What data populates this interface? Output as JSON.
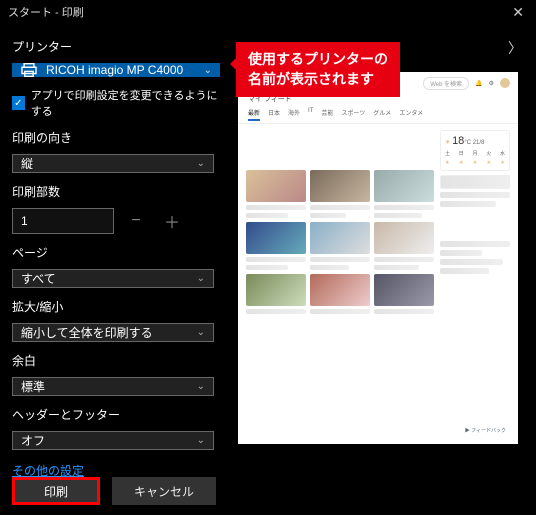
{
  "window": {
    "title": "スタート - 印刷"
  },
  "printer": {
    "section_label": "プリンター",
    "name": "RICOH imagio MP C4000",
    "app_override_label": "アプリで印刷設定を変更できるようにする"
  },
  "orientation": {
    "label": "印刷の向き",
    "value": "縦"
  },
  "copies": {
    "label": "印刷部数",
    "value": "1"
  },
  "pages": {
    "label": "ページ",
    "value": "すべて"
  },
  "scale": {
    "label": "拡大/縮小",
    "value": "縮小して全体を印刷する"
  },
  "margin": {
    "label": "余白",
    "value": "標準"
  },
  "header_footer": {
    "label": "ヘッダーとフッター",
    "value": "オフ"
  },
  "more_settings": "その他の設定",
  "buttons": {
    "print": "印刷",
    "cancel": "キャンセル"
  },
  "callout": {
    "line1": "使用するプリンターの",
    "line2": "名前が表示されます"
  },
  "preview": {
    "search_placeholder": "Web を検索",
    "feed_title": "マイ フィード",
    "tabs": [
      "最新",
      "日本",
      "海外",
      "IT",
      "芸能",
      "スポーツ",
      "グルメ",
      "エンタメ"
    ],
    "weather": {
      "temp": "18",
      "unit": "°C",
      "hi": "21",
      "lo": "8",
      "days": [
        "土",
        "日",
        "月",
        "火",
        "水"
      ]
    },
    "footer_link": "フィードバック"
  }
}
